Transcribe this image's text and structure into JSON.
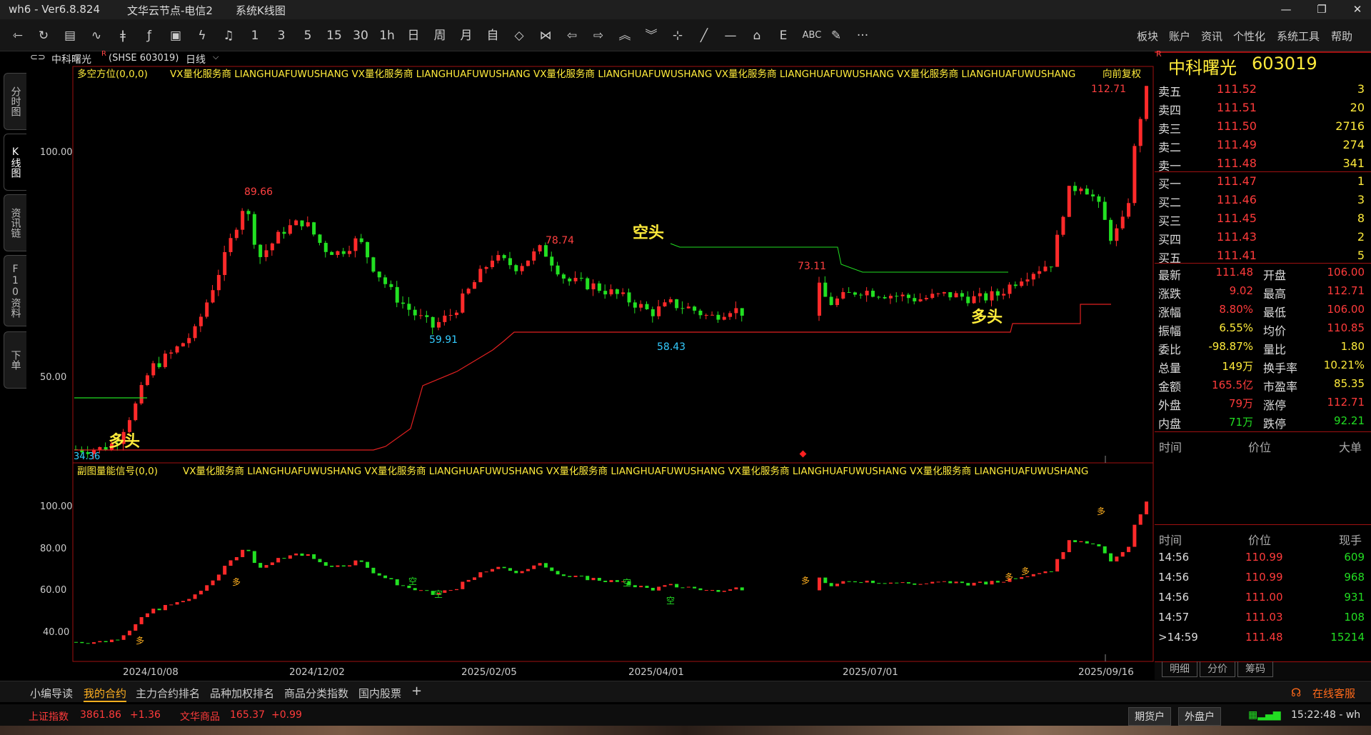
{
  "window": {
    "title": "wh6  -  Ver6.8.824",
    "server": "文华云节点-电信2",
    "mode": "系统K线图",
    "min": "—",
    "max": "❐",
    "close": "✕"
  },
  "toolbar": {
    "icons": [
      "back-arrow-icon",
      "refresh-icon",
      "table-icon",
      "line-chart-icon",
      "bar-icon",
      "formula-icon",
      "screen-icon",
      "lightning-icon",
      "bell-icon"
    ],
    "periods": [
      "1",
      "3",
      "5",
      "15",
      "30",
      "1h",
      "日",
      "周",
      "月",
      "自"
    ],
    "menu": [
      "板块",
      "账户",
      "资讯",
      "个性化",
      "系统工具",
      "帮助"
    ],
    "draw_labels": {
      "abc": "ABC",
      "e": "E",
      "more": "···"
    }
  },
  "left_tabs": [
    {
      "label": "分时图"
    },
    {
      "label": "K线图"
    },
    {
      "label": "资讯链"
    },
    {
      "label": "F10资料"
    },
    {
      "label": "下单"
    }
  ],
  "symbol": {
    "name": "中科曙光",
    "superscript": "R",
    "code": "(SHSE 603019)",
    "period": "日线"
  },
  "main_chart": {
    "indicator": "多空方位(0,0,0)",
    "watermark": "VX量化服务商  LIANGHUAFUWUSHANG  VX量化服务商  LIANGHUAFUWUSHANG  VX量化服务商  LIANGHUAFUWUSHANG  VX量化服务商  LIANGHUAFUWUSHANG  VX量化服务商  LIANGHUAFUWUSHANG",
    "adj": "向前复权",
    "yticks": [
      "100.00",
      "50.00"
    ],
    "annotations": {
      "high1": "89.66",
      "high2": "78.74",
      "high3": "73.11",
      "high4": "112.71",
      "low1": "59.91",
      "low2": "58.43",
      "low0": "34.36",
      "kongtou": "空头",
      "duotou1": "多头",
      "duotou2": "多头"
    }
  },
  "sub_chart": {
    "indicator": "副图量能信号(0,0)",
    "watermark": "VX量化服务商  LIANGHUAFUWUSHANG  VX量化服务商  LIANGHUAFUWUSHANG  VX量化服务商  LIANGHUAFUWUSHANG  VX量化服务商  LIANGHUAFUWUSHANG  VX量化服务商  LIANGHUAFUWUSHANG",
    "yticks": [
      "100.00",
      "80.00",
      "60.00",
      "40.00"
    ],
    "duo": "多",
    "kong": "空"
  },
  "xaxis": [
    "2024/10/08",
    "2024/12/02",
    "2025/02/05",
    "2025/04/01",
    "2025/07/01",
    "2025/09/16"
  ],
  "quote": {
    "name": "中科曙光",
    "code": "603019",
    "badge": "R",
    "asks": [
      {
        "label": "卖五",
        "price": "111.52",
        "vol": "3"
      },
      {
        "label": "卖四",
        "price": "111.51",
        "vol": "20"
      },
      {
        "label": "卖三",
        "price": "111.50",
        "vol": "2716"
      },
      {
        "label": "卖二",
        "price": "111.49",
        "vol": "274"
      },
      {
        "label": "卖一",
        "price": "111.48",
        "vol": "341"
      }
    ],
    "bids": [
      {
        "label": "买一",
        "price": "111.47",
        "vol": "1"
      },
      {
        "label": "买二",
        "price": "111.46",
        "vol": "3"
      },
      {
        "label": "买三",
        "price": "111.45",
        "vol": "8"
      },
      {
        "label": "买四",
        "price": "111.43",
        "vol": "2"
      },
      {
        "label": "买五",
        "price": "111.41",
        "vol": "5"
      }
    ],
    "stats": [
      {
        "l1": "最新",
        "v1": "111.48",
        "c1": "#ff3b3b",
        "l2": "开盘",
        "v2": "106.00",
        "c2": "#ff3b3b"
      },
      {
        "l1": "涨跌",
        "v1": "9.02",
        "c1": "#ff3b3b",
        "l2": "最高",
        "v2": "112.71",
        "c2": "#ff3b3b"
      },
      {
        "l1": "涨幅",
        "v1": "8.80%",
        "c1": "#ff3b3b",
        "l2": "最低",
        "v2": "106.00",
        "c2": "#ff3b3b"
      },
      {
        "l1": "振幅",
        "v1": "6.55%",
        "c1": "#ffeb3b",
        "l2": "均价",
        "v2": "110.85",
        "c2": "#ff3b3b"
      },
      {
        "l1": "委比",
        "v1": "-98.87%",
        "c1": "#ffeb3b",
        "l2": "量比",
        "v2": "1.80",
        "c2": "#ffeb3b"
      },
      {
        "l1": "总量",
        "v1": "149万",
        "c1": "#ffeb3b",
        "l2": "换手率",
        "v2": "10.21%",
        "c2": "#ffeb3b"
      },
      {
        "l1": "金额",
        "v1": "165.5亿",
        "c1": "#ff3b3b",
        "l2": "市盈率",
        "v2": "85.35",
        "c2": "#ffeb3b"
      },
      {
        "l1": "外盘",
        "v1": "79万",
        "c1": "#ff3b3b",
        "l2": "涨停",
        "v2": "112.71",
        "c2": "#ff3b3b"
      },
      {
        "l1": "内盘",
        "v1": "71万",
        "c1": "#22dd22",
        "l2": "跌停",
        "v2": "92.21",
        "c2": "#22dd22"
      }
    ],
    "big_header": {
      "time": "时间",
      "price": "价位",
      "vol": "大单"
    },
    "tick_header": {
      "time": "时间",
      "price": "价位",
      "vol": "现手"
    },
    "ticks": [
      {
        "time": "14:56",
        "price": "110.99",
        "vol": "609"
      },
      {
        "time": "14:56",
        "price": "110.99",
        "vol": "968"
      },
      {
        "time": "14:56",
        "price": "111.00",
        "vol": "931"
      },
      {
        "time": "14:57",
        "price": "111.03",
        "vol": "108"
      },
      {
        "time": ">14:59",
        "price": "111.48",
        "vol": "15214"
      }
    ],
    "tabs": [
      "明细",
      "分价",
      "筹码"
    ]
  },
  "bottom_tabs": [
    "小编导读",
    "我的合约",
    "主力合约排名",
    "品种加权排名",
    "商品分类指数",
    "国内股票",
    "+"
  ],
  "online": "在线客服",
  "status": {
    "idx1": "上证指数",
    "v1": "3861.86",
    "c1": "+1.36",
    "idx2": "文华商品",
    "v2": "165.37",
    "c2": "+0.99",
    "btn1": "期货户",
    "btn2": "外盘户",
    "time": "15:22:48 - wh"
  },
  "colors": {
    "up": "#ff2a2a",
    "down": "#22e022",
    "annot": "#ffeb3b",
    "low": "#33ccff",
    "border": "#b01010"
  }
}
